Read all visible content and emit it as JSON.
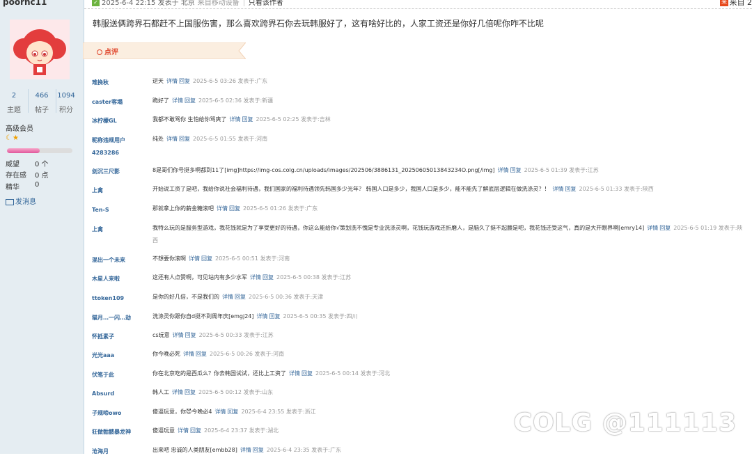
{
  "sidebar": {
    "username": "poorhc11",
    "stats": [
      {
        "num": "2",
        "label": "主题"
      },
      {
        "num": "466",
        "label": "帖子"
      },
      {
        "num": "1094",
        "label": "积分"
      }
    ],
    "rank": "高级会员",
    "progress": 0.5,
    "attrs": [
      {
        "label": "威望",
        "value": "0 个"
      },
      {
        "label": "存在感",
        "value": "0 点"
      },
      {
        "label": "精华",
        "value": "0"
      }
    ],
    "message_label": "发消息"
  },
  "topbar": {
    "time": "2025-6-4 22:15 发表于 北京",
    "via": "来自移动设备",
    "author_only": "只看该作者",
    "prev_icon": "来",
    "prev_text": "来自 2"
  },
  "post": {
    "content": "韩服送俩跨界石都赶不上国服伤害，那么喜欢跨界石你去玩韩服好了，这有啥好比的，人家工资还是你好几倍呢你咋不比呢"
  },
  "comment_section": {
    "label": "点评"
  },
  "comments": [
    {
      "name": "难挽秋",
      "text": "逆天",
      "detail": "详情",
      "reply": "回复",
      "meta": "2025-6-5 03:26 发表于:广东"
    },
    {
      "name": "caster客塌",
      "text": "跪好了",
      "detail": "详情",
      "reply": "回复",
      "meta": "2025-6-5 02:36 发表于:新疆"
    },
    {
      "name": "冰柠檬GL",
      "text": "我都不敢骂你 生怕给你骂爽了",
      "detail": "详情",
      "reply": "回复",
      "meta": "2025-6-5 02:25 发表于:吉林"
    },
    {
      "name": "昵称违规用户\n4283286",
      "text": "纯处",
      "detail": "详情",
      "reply": "回复",
      "meta": "2025-6-5 01:55 发表于:河南"
    },
    {
      "name": "剑沉三尺影",
      "text": "8是哥们你号挺多啊都到11了[img]https://img-cos.colg.cn/uploads/images/202506/3886131_20250605013843234O.png[/img]",
      "detail": "详情",
      "reply": "回复",
      "meta": "2025-6-5 01:39 发表于:江苏"
    },
    {
      "name": "上禽",
      "text": "开始说工资了是吧，我给你说社会福利待遇，我们国家的福利待遇领先韩国多少光年？ 韩国人口是多少，我国人口是多少，能不能先了解底层逻辑在做洗涤灵？！",
      "detail": "详情",
      "reply": "回复",
      "meta": "2025-6-5 01:33 发表于:陕西"
    },
    {
      "name": "Ten-S",
      "text": "那就拿上你的薪金糖滚吧",
      "detail": "详情",
      "reply": "回复",
      "meta": "2025-6-5 01:26 发表于:广东"
    },
    {
      "name": "上禽",
      "text": "我特么玩的是服务型游戏，我花钱就是为了享受更好的待遇，你这么能给你√策划洗不愧是专业洗涤灵啊，花钱玩游戏还折磨人，是脑久了挺不起腰是吧，我花钱还受这气，真的是大开眼界啊[emry14]",
      "detail": "详情",
      "reply": "回复",
      "meta": "2025-6-5 01:19 发表于:陕西"
    },
    {
      "name": "混出一个未来",
      "text": "不想要你滚啊",
      "detail": "详情",
      "reply": "回复",
      "meta": "2025-6-5 00:51 发表于:河南"
    },
    {
      "name": "木星人来啦",
      "text": "这还有人点赞啊，可见站内有多少水军",
      "detail": "详情",
      "reply": "回复",
      "meta": "2025-6-5 00:38 发表于:江苏"
    },
    {
      "name": "ttoken109",
      "text": "是你的好几倍，不是我们的",
      "detail": "详情",
      "reply": "回复",
      "meta": "2025-6-5 00:36 发表于:天津"
    },
    {
      "name": "猫月…一闪…劫",
      "text": "洗涤灵你跟你自d挺不到周年庆[emgj24]",
      "detail": "详情",
      "reply": "回复",
      "meta": "2025-6-5 00:35 发表于:四川"
    },
    {
      "name": "怀抵素子",
      "text": "cs玩意",
      "detail": "详情",
      "reply": "回复",
      "meta": "2025-6-5 00:33 发表于:江苏"
    },
    {
      "name": "光光aaa",
      "text": "你今晚必死",
      "detail": "详情",
      "reply": "回复",
      "meta": "2025-6-5 00:26 发表于:河南"
    },
    {
      "name": "伏笔于此",
      "text": "你在北京吃的是西瓜么？你去韩国试试，还比上工资了",
      "detail": "详情",
      "reply": "回复",
      "meta": "2025-6-5 00:14 发表于:河北"
    },
    {
      "name": "Absurd",
      "text": "韩人工",
      "detail": "详情",
      "reply": "回复",
      "meta": "2025-6-5 00:12 发表于:山东"
    },
    {
      "name": "子规啼owo",
      "text": "傻逼玩意，你😈今晚必4",
      "detail": "详情",
      "reply": "回复",
      "meta": "2025-6-4 23:55 发表于:浙江"
    },
    {
      "name": "狂做骷髅暴龙神",
      "text": "傻逼玩意",
      "detail": "详情",
      "reply": "回复",
      "meta": "2025-6-4 23:37 发表于:湖北"
    },
    {
      "name": "沧海月",
      "text": "出来吧 忠诚的人类朋友[embb28]",
      "detail": "详情",
      "reply": "回复",
      "meta": "2025-6-4 23:35 发表于:广东"
    }
  ],
  "watermark": "COLG @111113"
}
